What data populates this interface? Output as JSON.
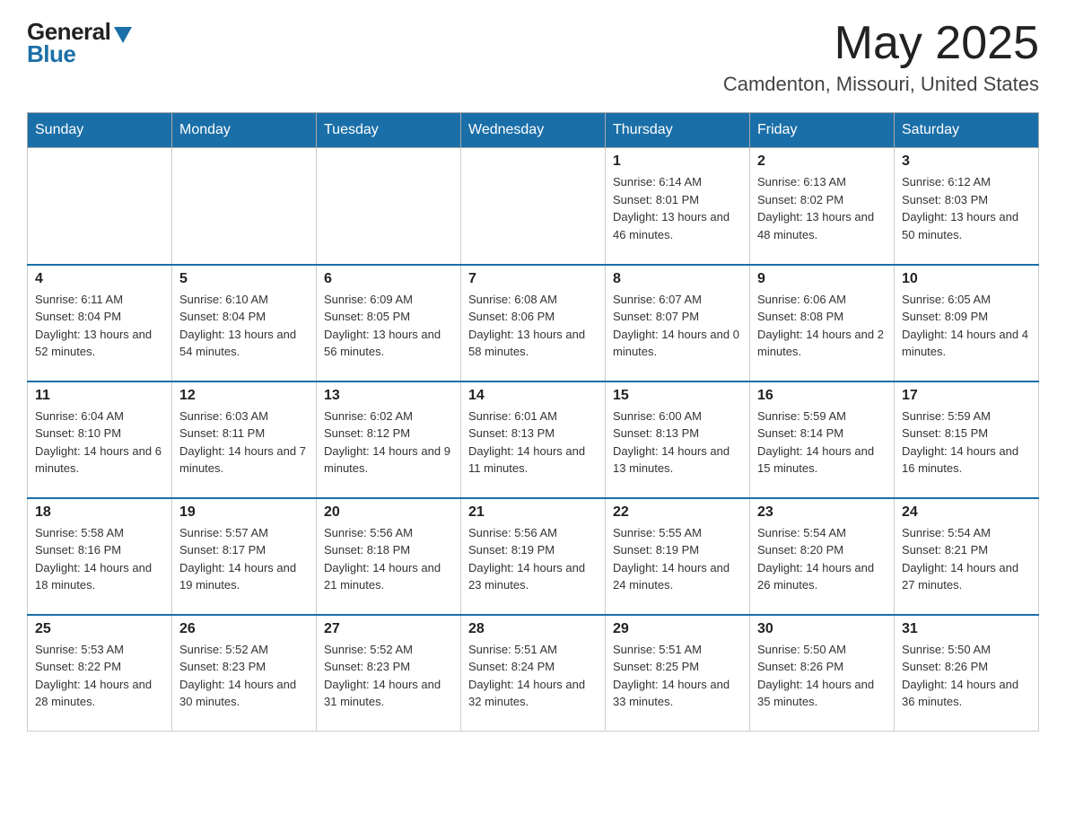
{
  "header": {
    "logo_general": "General",
    "logo_blue": "Blue",
    "month_title": "May 2025",
    "location": "Camdenton, Missouri, United States"
  },
  "days_of_week": [
    "Sunday",
    "Monday",
    "Tuesday",
    "Wednesday",
    "Thursday",
    "Friday",
    "Saturday"
  ],
  "weeks": [
    [
      {
        "day": "",
        "info": ""
      },
      {
        "day": "",
        "info": ""
      },
      {
        "day": "",
        "info": ""
      },
      {
        "day": "",
        "info": ""
      },
      {
        "day": "1",
        "info": "Sunrise: 6:14 AM\nSunset: 8:01 PM\nDaylight: 13 hours and 46 minutes."
      },
      {
        "day": "2",
        "info": "Sunrise: 6:13 AM\nSunset: 8:02 PM\nDaylight: 13 hours and 48 minutes."
      },
      {
        "day": "3",
        "info": "Sunrise: 6:12 AM\nSunset: 8:03 PM\nDaylight: 13 hours and 50 minutes."
      }
    ],
    [
      {
        "day": "4",
        "info": "Sunrise: 6:11 AM\nSunset: 8:04 PM\nDaylight: 13 hours and 52 minutes."
      },
      {
        "day": "5",
        "info": "Sunrise: 6:10 AM\nSunset: 8:04 PM\nDaylight: 13 hours and 54 minutes."
      },
      {
        "day": "6",
        "info": "Sunrise: 6:09 AM\nSunset: 8:05 PM\nDaylight: 13 hours and 56 minutes."
      },
      {
        "day": "7",
        "info": "Sunrise: 6:08 AM\nSunset: 8:06 PM\nDaylight: 13 hours and 58 minutes."
      },
      {
        "day": "8",
        "info": "Sunrise: 6:07 AM\nSunset: 8:07 PM\nDaylight: 14 hours and 0 minutes."
      },
      {
        "day": "9",
        "info": "Sunrise: 6:06 AM\nSunset: 8:08 PM\nDaylight: 14 hours and 2 minutes."
      },
      {
        "day": "10",
        "info": "Sunrise: 6:05 AM\nSunset: 8:09 PM\nDaylight: 14 hours and 4 minutes."
      }
    ],
    [
      {
        "day": "11",
        "info": "Sunrise: 6:04 AM\nSunset: 8:10 PM\nDaylight: 14 hours and 6 minutes."
      },
      {
        "day": "12",
        "info": "Sunrise: 6:03 AM\nSunset: 8:11 PM\nDaylight: 14 hours and 7 minutes."
      },
      {
        "day": "13",
        "info": "Sunrise: 6:02 AM\nSunset: 8:12 PM\nDaylight: 14 hours and 9 minutes."
      },
      {
        "day": "14",
        "info": "Sunrise: 6:01 AM\nSunset: 8:13 PM\nDaylight: 14 hours and 11 minutes."
      },
      {
        "day": "15",
        "info": "Sunrise: 6:00 AM\nSunset: 8:13 PM\nDaylight: 14 hours and 13 minutes."
      },
      {
        "day": "16",
        "info": "Sunrise: 5:59 AM\nSunset: 8:14 PM\nDaylight: 14 hours and 15 minutes."
      },
      {
        "day": "17",
        "info": "Sunrise: 5:59 AM\nSunset: 8:15 PM\nDaylight: 14 hours and 16 minutes."
      }
    ],
    [
      {
        "day": "18",
        "info": "Sunrise: 5:58 AM\nSunset: 8:16 PM\nDaylight: 14 hours and 18 minutes."
      },
      {
        "day": "19",
        "info": "Sunrise: 5:57 AM\nSunset: 8:17 PM\nDaylight: 14 hours and 19 minutes."
      },
      {
        "day": "20",
        "info": "Sunrise: 5:56 AM\nSunset: 8:18 PM\nDaylight: 14 hours and 21 minutes."
      },
      {
        "day": "21",
        "info": "Sunrise: 5:56 AM\nSunset: 8:19 PM\nDaylight: 14 hours and 23 minutes."
      },
      {
        "day": "22",
        "info": "Sunrise: 5:55 AM\nSunset: 8:19 PM\nDaylight: 14 hours and 24 minutes."
      },
      {
        "day": "23",
        "info": "Sunrise: 5:54 AM\nSunset: 8:20 PM\nDaylight: 14 hours and 26 minutes."
      },
      {
        "day": "24",
        "info": "Sunrise: 5:54 AM\nSunset: 8:21 PM\nDaylight: 14 hours and 27 minutes."
      }
    ],
    [
      {
        "day": "25",
        "info": "Sunrise: 5:53 AM\nSunset: 8:22 PM\nDaylight: 14 hours and 28 minutes."
      },
      {
        "day": "26",
        "info": "Sunrise: 5:52 AM\nSunset: 8:23 PM\nDaylight: 14 hours and 30 minutes."
      },
      {
        "day": "27",
        "info": "Sunrise: 5:52 AM\nSunset: 8:23 PM\nDaylight: 14 hours and 31 minutes."
      },
      {
        "day": "28",
        "info": "Sunrise: 5:51 AM\nSunset: 8:24 PM\nDaylight: 14 hours and 32 minutes."
      },
      {
        "day": "29",
        "info": "Sunrise: 5:51 AM\nSunset: 8:25 PM\nDaylight: 14 hours and 33 minutes."
      },
      {
        "day": "30",
        "info": "Sunrise: 5:50 AM\nSunset: 8:26 PM\nDaylight: 14 hours and 35 minutes."
      },
      {
        "day": "31",
        "info": "Sunrise: 5:50 AM\nSunset: 8:26 PM\nDaylight: 14 hours and 36 minutes."
      }
    ]
  ]
}
